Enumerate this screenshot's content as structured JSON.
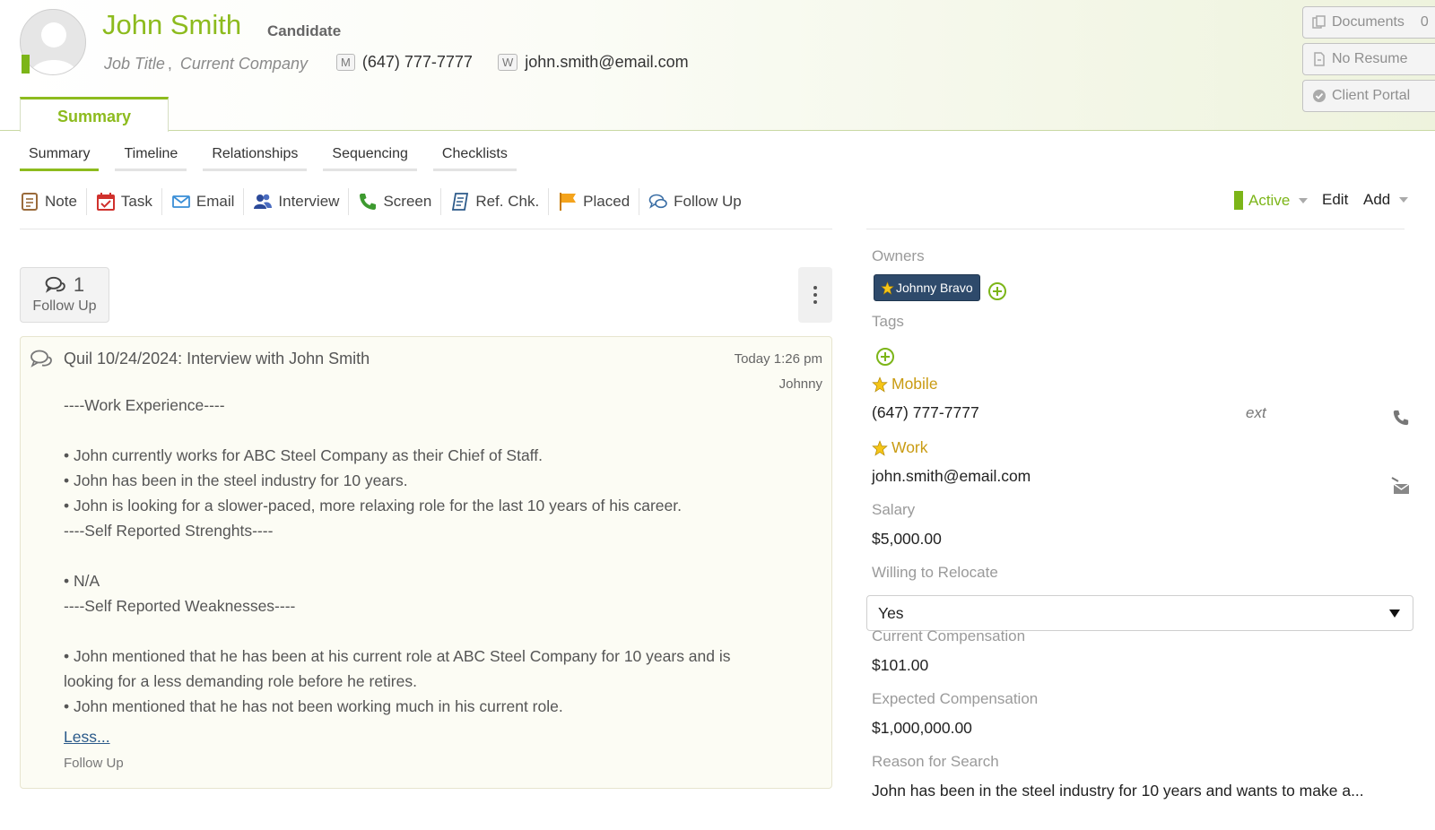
{
  "candidate": {
    "name": "John Smith",
    "role": "Candidate",
    "job_title": "Job Title",
    "comma": ",",
    "company": "Current Company",
    "phone_badge": "M",
    "phone": "(647) 777-7777",
    "email_badge": "W",
    "email": "john.smith@email.com"
  },
  "right_buttons": {
    "documents": "Documents",
    "documents_count": "0",
    "no_resume": "No Resume",
    "client_portal": "Client Portal"
  },
  "top_tab": "Summary",
  "subtabs": [
    "Summary",
    "Timeline",
    "Relationships",
    "Sequencing",
    "Checklists"
  ],
  "actions": [
    "Note",
    "Task",
    "Email",
    "Interview",
    "Screen",
    "Ref. Chk.",
    "Placed",
    "Follow Up"
  ],
  "status": {
    "label": "Active",
    "status_color": "#7cb518",
    "edit": "Edit",
    "add": "Add"
  },
  "follow_up_card": {
    "count": "1",
    "label": "Follow Up"
  },
  "note": {
    "title": "Quil 10/24/2024: Interview with John Smith",
    "time": "Today 1:26 pm",
    "user": "Johnny",
    "lines": [
      "----Work Experience----",
      "",
      "• John currently works for ABC Steel Company as their Chief of Staff.",
      "• John has been in the steel industry for 10 years.",
      "• John is looking for a slower-paced, more relaxing role for the last 10 years of his career.",
      "----Self Reported Strenghts----",
      "",
      "• N/A",
      "----Self Reported Weaknesses----",
      "",
      "• John mentioned that he has been at his current role at ABC Steel Company for 10 years and is",
      "looking for a less demanding role before he retires.",
      "• John mentioned that he has not been working much in his current role."
    ],
    "less_link": "Less...",
    "footer": "Follow Up"
  },
  "details": {
    "owners_label": "Owners",
    "owner_name": "Johnny Bravo",
    "tags_label": "Tags",
    "mobile_label": "Mobile",
    "mobile_value": "(647) 777-7777",
    "ext_label": "ext",
    "work_label": "Work",
    "work_value": "john.smith@email.com",
    "salary_label": "Salary",
    "salary_value": "$5,000.00",
    "relocate_label": "Willing to Relocate",
    "relocate_value": "Yes",
    "current_comp_label": "Current Compensation",
    "current_comp_value": "$101.00",
    "expected_comp_label": "Expected Compensation",
    "expected_comp_value": "$1,000,000.00",
    "reason_label": "Reason for Search",
    "reason_value": "John has been in the steel industry for 10 years and wants to make a..."
  },
  "icons": {
    "avatar": "person-silhouette-icon",
    "documents": "documents-icon",
    "no_resume": "file-icon",
    "client_portal": "check-badge-icon",
    "note": "note-icon",
    "task": "calendar-check-icon",
    "email": "envelope-icon",
    "interview": "people-icon",
    "screen": "phone-icon",
    "ref_chk": "checklist-icon",
    "placed": "flag-icon",
    "follow_up": "chat-bubbles-icon",
    "kebab": "more-vertical-icon",
    "owner_star": "star-icon",
    "add": "plus-circle-icon",
    "call": "phone-icon",
    "send_mail": "mail-send-icon"
  }
}
